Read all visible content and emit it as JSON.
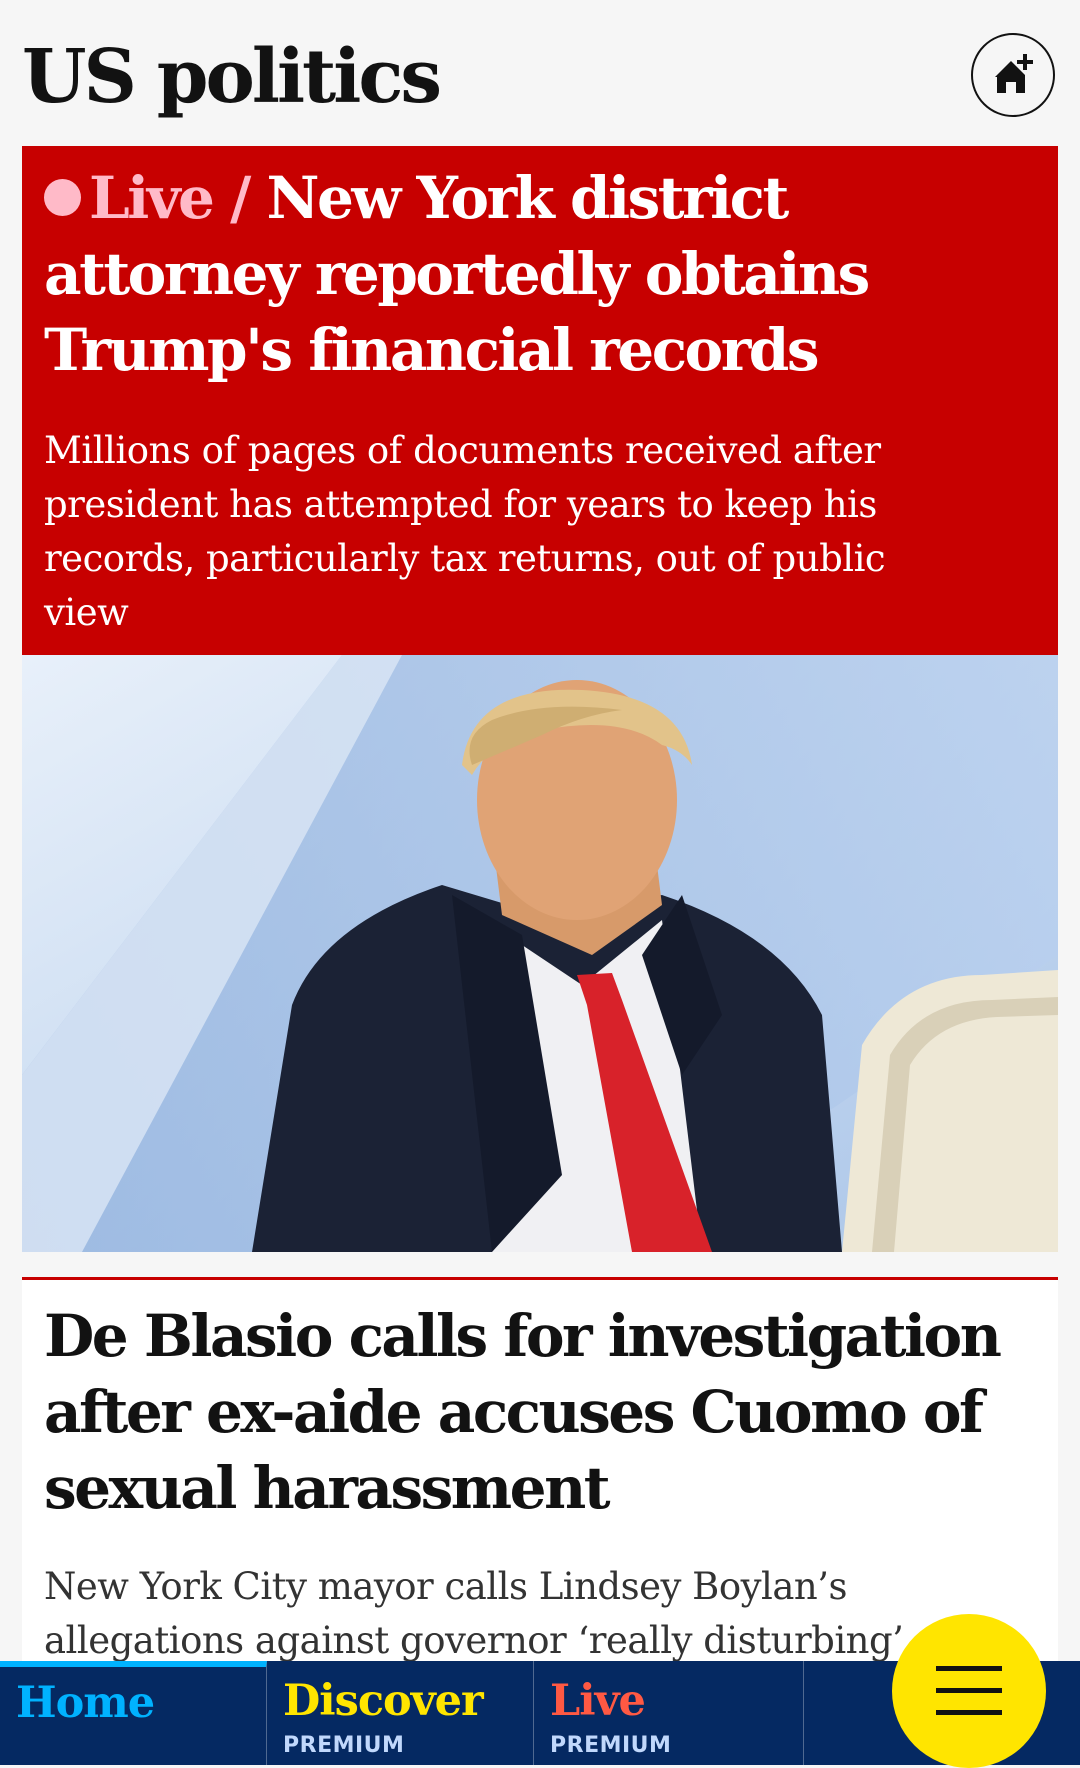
{
  "header": {
    "title": "US politics",
    "home_add_icon": "home-plus-icon"
  },
  "live_card": {
    "kicker": "Live /",
    "headline": "New York district attorney reportedly obtains Trump's financial records",
    "standfirst": "Millions of pages of documents received after president has attempted for years to keep his records, particularly tax returns, out of public view",
    "image_icon": "photo-image"
  },
  "second_card": {
    "headline": "De Blasio calls for investigation after ex-aide accuses Cuomo of sexual harassment",
    "standfirst": "New York City mayor calls Lindsey Boylan’s allegations against governor ‘really disturbing’"
  },
  "bottom_nav": {
    "home": {
      "label": "Home",
      "color": "#00b2ff"
    },
    "discover": {
      "label": "Discover",
      "sub": "PREMIUM",
      "color": "#ffe500"
    },
    "live": {
      "label": "Live",
      "sub": "PREMIUM",
      "color": "#ff5943"
    },
    "menu_icon": "hamburger-menu-icon"
  },
  "colors": {
    "live_red": "#c70000",
    "live_pink": "#ffbac8",
    "nav_blue": "#052962",
    "menu_yellow": "#ffe500"
  }
}
